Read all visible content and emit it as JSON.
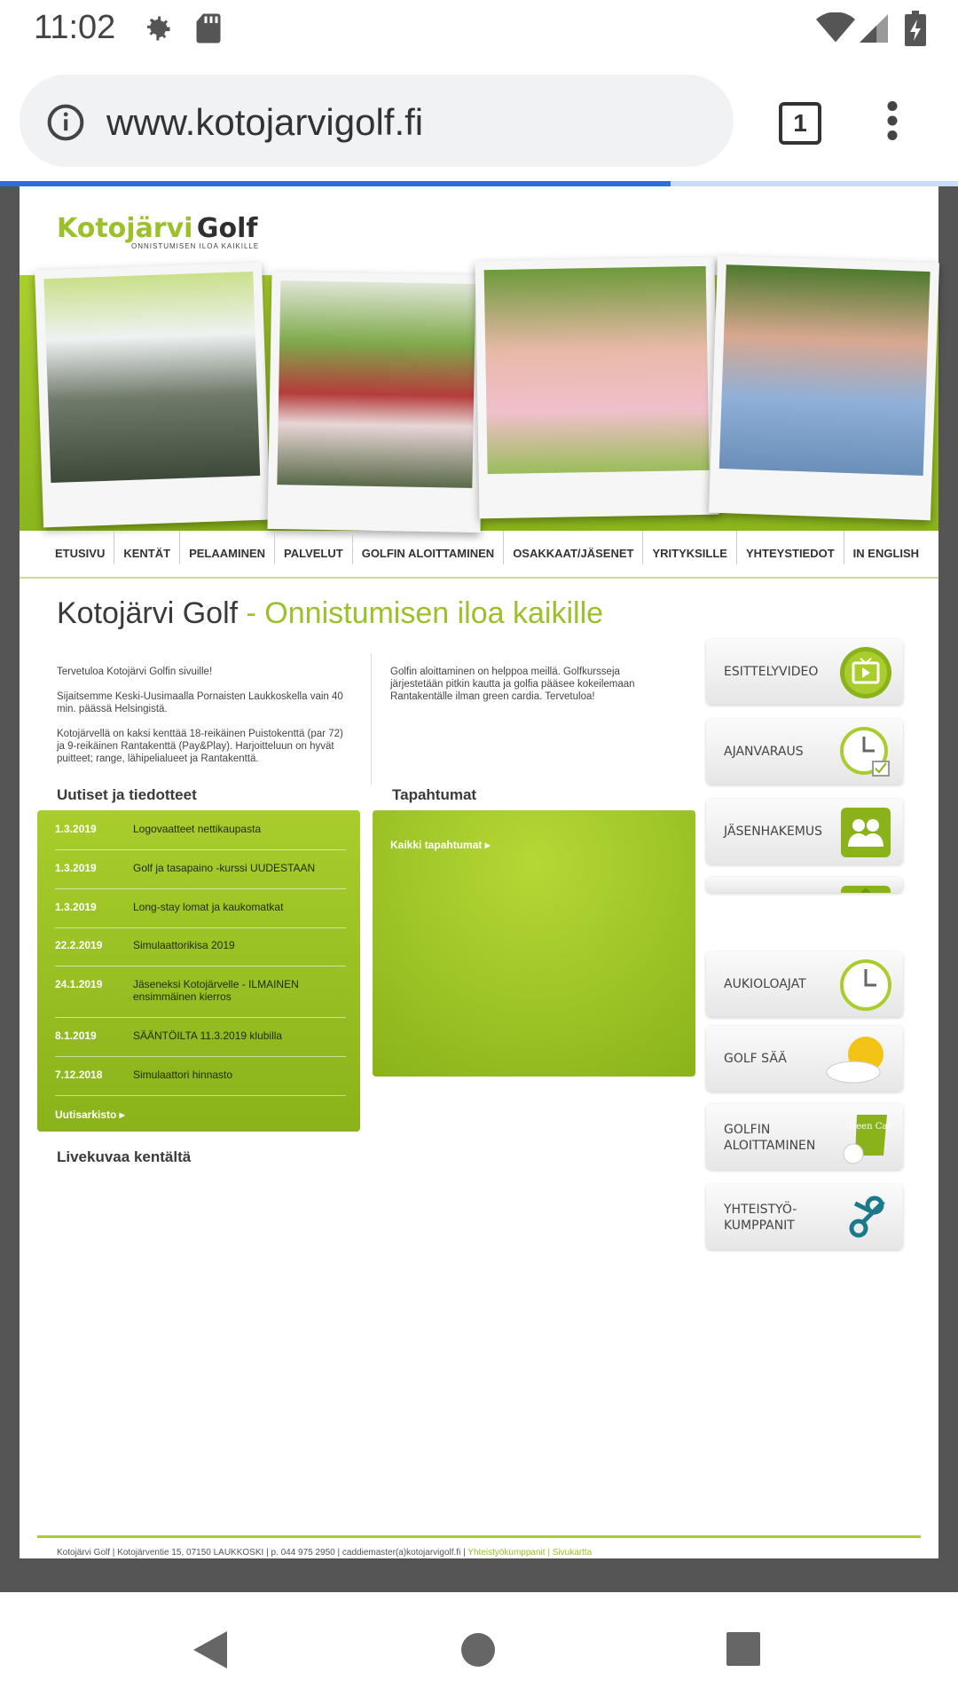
{
  "status_bar": {
    "time": "11:02"
  },
  "browser": {
    "url": "www.kotojarvigolf.fi",
    "tab_count": "1",
    "load_progress": 0.7
  },
  "logo": {
    "part1": "Kotojärvi",
    "part2": "Golf",
    "tagline": "ONNISTUMISEN ILOA KAIKILLE"
  },
  "nav": {
    "items": [
      "ETUSIVU",
      "KENTÄT",
      "PELAAMINEN",
      "PALVELUT",
      "GOLFIN ALOITTAMINEN",
      "OSAKKAAT/JÄSENET",
      "YRITYKSILLE",
      "YHTEYSTIEDOT",
      "IN ENGLISH"
    ]
  },
  "heading": {
    "main": "Kotojärvi Golf",
    "sub": " - Onnistumisen iloa kaikille"
  },
  "intro": {
    "p1": "Tervetuloa Kotojärvi Golfin sivuille!",
    "p2": "Sijaitsemme Keski-Uusimaalla Pornaisten Laukkoskella vain 40 min. päässä Helsingistä.",
    "p3": "Kotojärvellä on kaksi kenttää 18-reikäinen Puistokenttä (par 72) ja 9-reikäinen Rantakenttä (Pay&Play). Harjoitteluun on hyvät puitteet; range, lähipelialueet ja Rantakenttä.",
    "right": "Golfin aloittaminen on helppoa meillä. Golfkursseja järjestetään pitkin kautta ja golfia pääsee kokeilemaan Rantakentälle ilman green cardia. Tervetuloa!"
  },
  "news": {
    "title": "Uutiset ja tiedotteet",
    "items": [
      {
        "date": "1.3.2019",
        "text": "Logovaatteet nettikaupasta"
      },
      {
        "date": "1.3.2019",
        "text": "Golf ja tasapaino -kurssi UUDESTAAN"
      },
      {
        "date": "1.3.2019",
        "text": "Long-stay lomat ja kaukomatkat"
      },
      {
        "date": "22.2.2019",
        "text": "Simulaattorikisa 2019"
      },
      {
        "date": "24.1.2019",
        "text": "Jäseneksi Kotojärvelle - ILMAINEN ensimmäinen kierros"
      },
      {
        "date": "8.1.2019",
        "text": "SÄÄNTÖILTA 11.3.2019 klubilla"
      },
      {
        "date": "7.12.2018",
        "text": "Simulaattori hinnasto"
      }
    ],
    "archive": "Uutisarkisto ▸"
  },
  "events": {
    "title": "Tapahtumat",
    "all": "Kaikki tapahtumat ▸"
  },
  "live": {
    "title": "Livekuvaa kentältä"
  },
  "side_buttons": {
    "video": "ESITTELYVIDEO",
    "booking": "AJANVARAUS",
    "member": "JÄSENHAKEMUS",
    "hours": "AUKIOLOAJAT",
    "weather": "GOLF SÄÄ",
    "start1": "GOLFIN",
    "start2": "ALOITTAMINEN",
    "partner1": "YHTEISTYÖ-",
    "partner2": "KUMPPANIT",
    "green_card": "Green Card"
  },
  "footer": {
    "name": "Kotojärvi Golf",
    "address": "Kotojärventie 15, 07150 LAUKKOSKI",
    "phone": "p. 044 975 2950",
    "email": "caddiemaster(a)kotojarvigolf.fi",
    "link1": "Yhteistyökumppanit",
    "link2": "Sivukartta"
  }
}
